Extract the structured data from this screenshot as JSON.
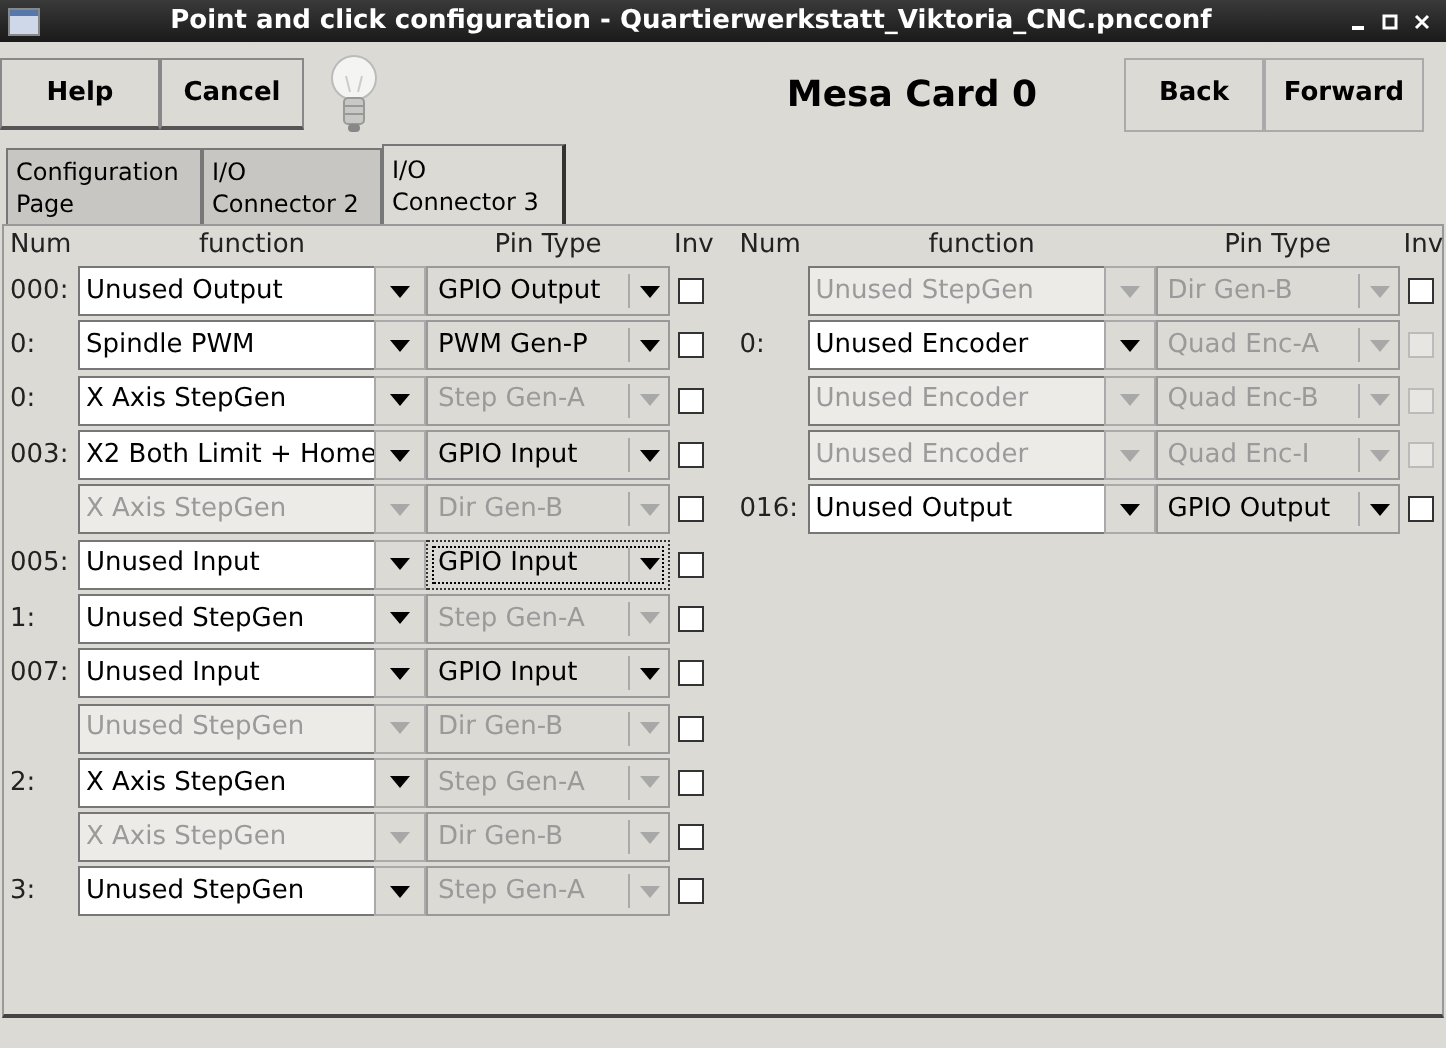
{
  "window": {
    "title": "Point and click configuration - Quartierwerkstatt_Viktoria_CNC.pncconf"
  },
  "toolbar": {
    "left_buttons": [
      "Help",
      "Cancel"
    ],
    "heading": "Mesa Card 0",
    "right_buttons": [
      "Back",
      "Forward"
    ]
  },
  "tabs": [
    {
      "label": "Configuration Page",
      "selected": false
    },
    {
      "label": "I/O Connector 2",
      "selected": false
    },
    {
      "label": "I/O Connector 3",
      "selected": true
    }
  ],
  "left_columns": {
    "num": "Num",
    "function": "function",
    "pin_type": "Pin Type",
    "inv": "Inv"
  },
  "right_columns": {
    "num": "Num",
    "function": "function",
    "pin_type": "Pin Type",
    "inv": "Inv"
  },
  "left_rows": [
    {
      "num": "000:",
      "function": "Unused Output",
      "function_disabled": false,
      "pin_type": "GPIO Output",
      "pin_disabled": false,
      "focused": false,
      "inv_checked": false,
      "inv_disabled": false
    },
    {
      "num": "0:",
      "function": "Spindle PWM",
      "function_disabled": false,
      "pin_type": "PWM Gen-P",
      "pin_disabled": false,
      "focused": false,
      "inv_checked": false,
      "inv_disabled": false
    },
    {
      "num": "0:",
      "function": "X Axis StepGen",
      "function_disabled": false,
      "pin_type": "Step Gen-A",
      "pin_disabled": true,
      "focused": false,
      "inv_checked": false,
      "inv_disabled": false
    },
    {
      "num": "003:",
      "function": "X2 Both Limit + Home",
      "function_disabled": false,
      "pin_type": "GPIO Input",
      "pin_disabled": false,
      "focused": false,
      "inv_checked": false,
      "inv_disabled": false
    },
    {
      "function": "X Axis StepGen",
      "function_disabled": true,
      "pin_type": "Dir Gen-B",
      "pin_disabled": true,
      "focused": false,
      "inv_checked": false,
      "inv_disabled": false
    },
    {
      "num": "005:",
      "function": "Unused Input",
      "function_disabled": false,
      "pin_type": "GPIO Input",
      "pin_disabled": false,
      "focused": true,
      "inv_checked": false,
      "inv_disabled": false
    },
    {
      "num": "1:",
      "function": "Unused StepGen",
      "function_disabled": false,
      "pin_type": "Step Gen-A",
      "pin_disabled": true,
      "focused": false,
      "inv_checked": false,
      "inv_disabled": false
    },
    {
      "num": "007:",
      "function": "Unused Input",
      "function_disabled": false,
      "pin_type": "GPIO Input",
      "pin_disabled": false,
      "focused": false,
      "inv_checked": false,
      "inv_disabled": false
    },
    {
      "function": "Unused StepGen",
      "function_disabled": true,
      "pin_type": "Dir Gen-B",
      "pin_disabled": true,
      "focused": false,
      "inv_checked": false,
      "inv_disabled": false
    },
    {
      "num": "2:",
      "function": "X Axis StepGen",
      "function_disabled": false,
      "pin_type": "Step Gen-A",
      "pin_disabled": true,
      "focused": false,
      "inv_checked": false,
      "inv_disabled": false
    },
    {
      "function": "X Axis StepGen",
      "function_disabled": true,
      "pin_type": "Dir Gen-B",
      "pin_disabled": true,
      "focused": false,
      "inv_checked": false,
      "inv_disabled": false
    },
    {
      "num": "3:",
      "function": "Unused StepGen",
      "function_disabled": false,
      "pin_type": "Step Gen-A",
      "pin_disabled": true,
      "focused": false,
      "inv_checked": false,
      "inv_disabled": false
    }
  ],
  "right_rows": [
    {
      "function": "Unused StepGen",
      "function_disabled": true,
      "pin_type": "Dir Gen-B",
      "pin_disabled": true,
      "focused": false,
      "inv_checked": false,
      "inv_disabled": false
    },
    {
      "num": "0:",
      "function": "Unused Encoder",
      "function_disabled": false,
      "pin_type": "Quad Enc-A",
      "pin_disabled": true,
      "focused": false,
      "inv_checked": false,
      "inv_disabled": true
    },
    {
      "function": "Unused Encoder",
      "function_disabled": true,
      "pin_type": "Quad Enc-B",
      "pin_disabled": true,
      "focused": false,
      "inv_checked": false,
      "inv_disabled": true
    },
    {
      "function": "Unused Encoder",
      "function_disabled": true,
      "pin_type": "Quad Enc-I",
      "pin_disabled": true,
      "focused": false,
      "inv_checked": false,
      "inv_disabled": true
    },
    {
      "num": "016:",
      "function": "Unused Output",
      "function_disabled": false,
      "pin_type": "GPIO Output",
      "pin_disabled": false,
      "focused": false,
      "inv_checked": false,
      "inv_disabled": false
    }
  ]
}
